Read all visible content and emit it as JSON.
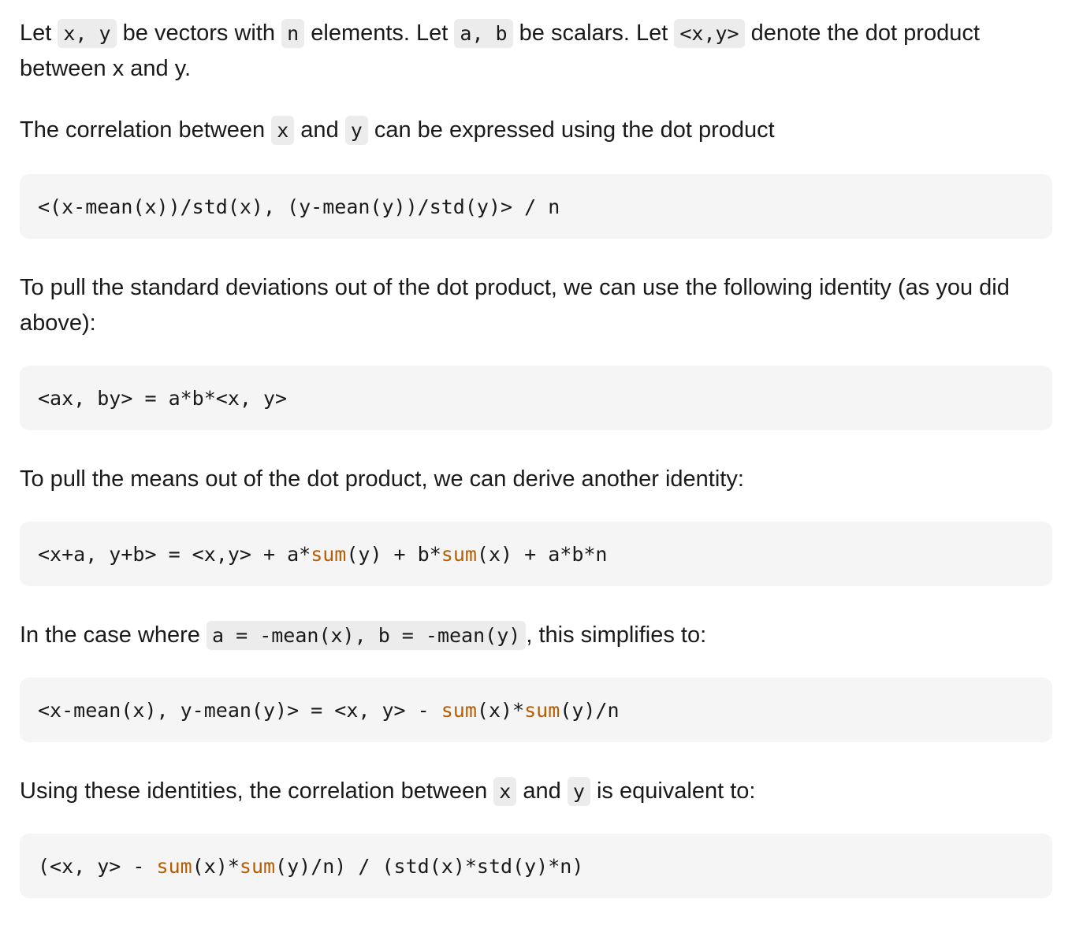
{
  "p1": {
    "t1": "Let ",
    "c1": "x, y",
    "t2": " be vectors with ",
    "c2": "n",
    "t3": " elements. Let ",
    "c3": "a, b",
    "t4": " be scalars. Let ",
    "c4": "<x,y>",
    "t5": " denote the dot product between x and y."
  },
  "p2": {
    "t1": "The correlation between ",
    "c1": "x",
    "t2": " and ",
    "c2": "y",
    "t3": " can be expressed using the dot product"
  },
  "code1": "<(x-mean(x))/std(x), (y-mean(y))/std(y)> / n",
  "p3": "To pull the standard deviations out of the dot product, we can use the following identity (as you did above):",
  "code2": "<ax, by> = a*b*<x, y>",
  "p4": "To pull the means out of the dot product, we can derive another identity:",
  "code3": {
    "s1": "<x+a, y+b> = <x,y> + a*",
    "f1": "sum",
    "s2": "(y) + b*",
    "f2": "sum",
    "s3": "(x) + a*b*n"
  },
  "p5": {
    "t1": "In the case where ",
    "c1": "a = -mean(x), b = -mean(y)",
    "t2": ", this simplifies to:"
  },
  "code4": {
    "s1": "<x-mean(x), y-mean(y)> = <x, y> - ",
    "f1": "sum",
    "s2": "(x)*",
    "f2": "sum",
    "s3": "(y)/n"
  },
  "p6": {
    "t1": "Using these identities, the correlation between ",
    "c1": "x",
    "t2": " and ",
    "c2": "y",
    "t3": " is equivalent to:"
  },
  "code5": {
    "s1": "(<x, y> - ",
    "f1": "sum",
    "s2": "(x)*",
    "f2": "sum",
    "s3": "(y)/n) / (std(x)*std(y)*n)"
  }
}
